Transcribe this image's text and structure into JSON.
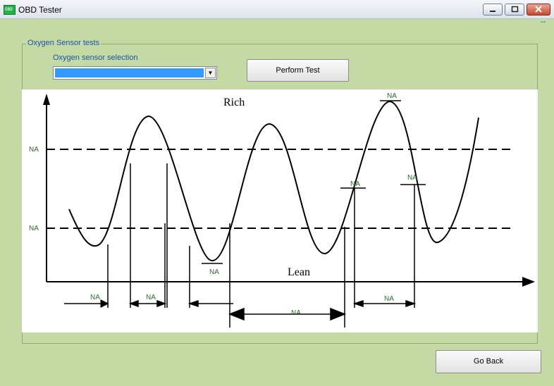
{
  "window": {
    "title": "OBD Tester",
    "status": "--"
  },
  "group": {
    "title": "Oxygen Sensor tests"
  },
  "selection": {
    "label": "Oxygen sensor selection",
    "value": ""
  },
  "buttons": {
    "perform": "Perform Test",
    "back": "Go Back"
  },
  "diagram": {
    "rich_label": "Rich",
    "lean_label": "Lean",
    "upper_threshold": "NA",
    "lower_threshold": "NA",
    "peak_value": "NA",
    "trough_value": "NA",
    "rise_value": "NA",
    "fall_value": "NA",
    "interval_1": "NA",
    "interval_2": "NA",
    "interval_3": "NA",
    "interval_4": "NA"
  }
}
